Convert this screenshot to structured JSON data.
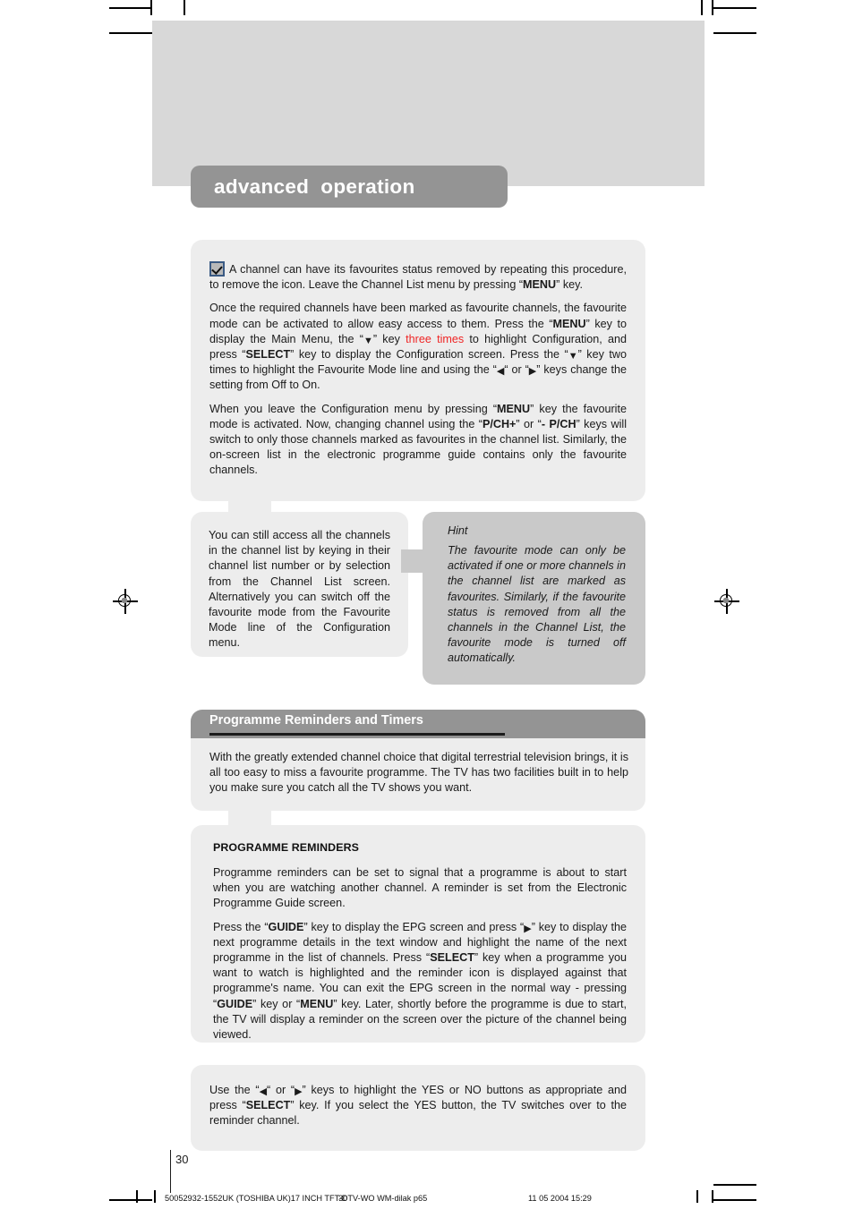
{
  "page": {
    "number": "30",
    "chapter_tab": "advanced  operation"
  },
  "blocks": {
    "note": {
      "p1_before_bold": "A channel can have its favourites status removed by repeating this procedure, to remove the icon. Leave the Channel List menu by pressing “",
      "p1_bold": "MENU",
      "p1_after": "” key.",
      "p2_a": "Once the required channels have been marked as favourite channels, the favourite mode can be activated to allow easy access to them. Press the “",
      "p2_b1": "MENU",
      "p2_c": "” key to display the Main Menu, the “",
      "p2_arrow1": "▼",
      "p2_d": "” key ",
      "p2_red": "three times",
      "p2_e": " to highlight Configuration, and press “",
      "p2_b2": "SELECT",
      "p2_f": "” key to display the Configuration screen. Press the “",
      "p2_arrow2": "▼",
      "p2_g": "” key two times to highlight the Favourite Mode line and using the “",
      "p2_arrow3": "◀",
      "p2_h": "“ or “",
      "p2_arrow4": "▶",
      "p2_i": "” keys change the setting from Off to On.",
      "p3_a": "When you leave the Configuration menu by pressing “",
      "p3_b1": "MENU",
      "p3_c": "” key the favourite mode is activated. Now, changing channel using the “",
      "p3_b2": "P/CH+",
      "p3_d": "” or “",
      "p3_b3": "- P/CH",
      "p3_e": "” keys will switch to only those channels marked as favourites in the channel list. Similarly, the on-screen list in the electronic programme guide contains only the favourite channels."
    },
    "access": {
      "text": "You can still access all the channels in the channel list by keying in their channel list number or by selection from the Channel List screen. Alternatively you can switch off the favourite mode from the Favourite Mode line of the Configuration menu."
    },
    "hint": {
      "label": "Hint",
      "text": "The favourite mode can only be activated if one or more channels in the channel list are marked as favourites. Similarly, if the favourite status is removed from all the channels in the Channel List, the favourite mode is turned off automatically."
    },
    "reminders_section": {
      "title": "Programme Reminders and Timers",
      "intro": "With the greatly extended channel choice that digital terrestrial television brings, it is all too easy to miss a favourite programme. The TV has two facilities built in to help you make sure you catch all the TV shows you want."
    },
    "programme_reminders": {
      "subhead": "PROGRAMME REMINDERS",
      "p1": "Programme reminders can be set to signal that a programme is about to start when you are watching another channel. A reminder is set from the Electronic Programme Guide screen.",
      "p2_a": "Press the “",
      "p2_b1": "GUIDE",
      "p2_c": "” key to display the EPG screen and press “",
      "p2_arrow1": "▶",
      "p2_d": "” key to display the next programme details in the text window and highlight the name of the next programme in the list of channels. Press “",
      "p2_b2": "SELECT",
      "p2_e": "” key when a programme you want to watch is highlighted and the reminder icon is displayed against that programme's name. You can exit the EPG screen in the normal way - pressing “",
      "p2_b3": "GUIDE",
      "p2_f": "” key or “",
      "p2_b4": "MENU",
      "p2_g": "” key. Later, shortly before the programme is due to start, the TV will display a reminder on the screen over the picture of the channel being viewed."
    },
    "yes_no": {
      "a": "Use the “",
      "arrow1": "◀",
      "b": "“ or “",
      "arrow2": "▶",
      "c": "” keys to highlight the YES or NO buttons as appropriate and press “",
      "bold": "SELECT",
      "d": "” key. If you select the YES button, the TV switches over to the reminder channel."
    }
  },
  "footer": {
    "left": "50052932-1552UK (TOSHIBA UK)17 INCH TFT-DTV-WO WM-dilak p65",
    "left_overlap": "30",
    "right": "11 05 2004  15:29"
  },
  "colors": {
    "header_band": "#d8d8d8",
    "tab": "#949494",
    "box_light": "#ededed",
    "box_dark": "#c9c9c9",
    "accent_red": "#ef2424",
    "checkbox_border": "#3a5a84"
  }
}
